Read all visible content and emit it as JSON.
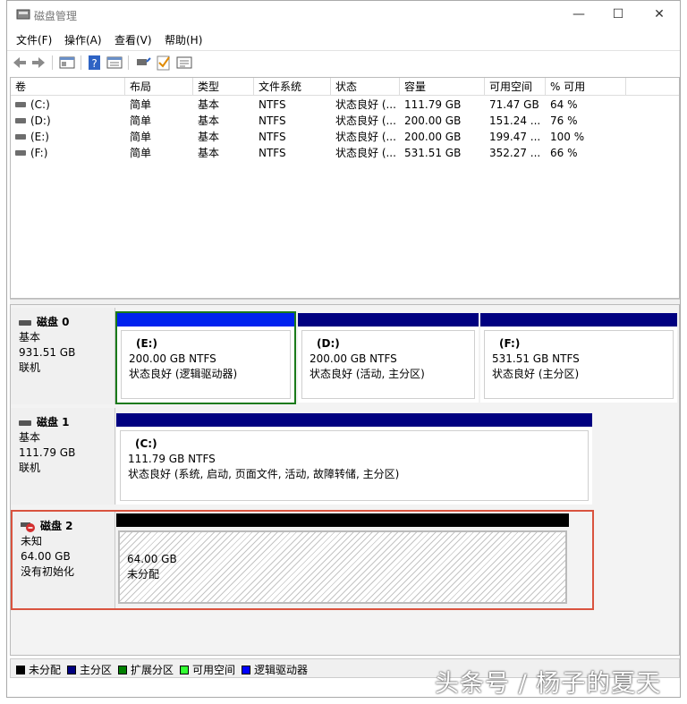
{
  "window": {
    "title": "磁盘管理",
    "minimize": "—",
    "maximize": "☐",
    "close": "✕"
  },
  "menu": [
    "文件(F)",
    "操作(A)",
    "查看(V)",
    "帮助(H)"
  ],
  "toolbar_icons": [
    "back-arrow-icon",
    "forward-arrow-icon",
    "console-tree-icon",
    "help-icon",
    "properties-icon",
    "connect-icon",
    "check-icon",
    "list-icon"
  ],
  "volume_table": {
    "columns": [
      "卷",
      "布局",
      "类型",
      "文件系统",
      "状态",
      "容量",
      "可用空间",
      "% 可用"
    ],
    "rows": [
      [
        "(C:)",
        "简单",
        "基本",
        "NTFS",
        "状态良好 (...",
        "111.79 GB",
        "71.47 GB",
        "64 %"
      ],
      [
        "(D:)",
        "简单",
        "基本",
        "NTFS",
        "状态良好 (...",
        "200.00 GB",
        "151.24 ...",
        "76 %"
      ],
      [
        "(E:)",
        "简单",
        "基本",
        "NTFS",
        "状态良好 (...",
        "200.00 GB",
        "199.47 ...",
        "100 %"
      ],
      [
        "(F:)",
        "简单",
        "基本",
        "NTFS",
        "状态良好 (...",
        "531.51 GB",
        "352.27 ...",
        "66 %"
      ]
    ]
  },
  "disks": [
    {
      "name": "磁盘 0",
      "type": "基本",
      "size": "931.51 GB",
      "status": "联机",
      "partitions": [
        {
          "label": "(E:)",
          "size": "200.00 GB NTFS",
          "status": "状态良好 (逻辑驱动器)"
        },
        {
          "label": "(D:)",
          "size": "200.00 GB NTFS",
          "status": "状态良好 (活动, 主分区)"
        },
        {
          "label": "(F:)",
          "size": "531.51 GB NTFS",
          "status": "状态良好 (主分区)"
        }
      ]
    },
    {
      "name": "磁盘 1",
      "type": "基本",
      "size": "111.79 GB",
      "status": "联机",
      "partitions": [
        {
          "label": "(C:)",
          "size": "111.79 GB NTFS",
          "status": "状态良好 (系统, 启动, 页面文件, 活动, 故障转储, 主分区)"
        }
      ]
    },
    {
      "name": "磁盘 2",
      "type": "未知",
      "size": "64.00 GB",
      "status": "没有初始化",
      "partitions": [
        {
          "size": "64.00 GB",
          "status": "未分配"
        }
      ]
    }
  ],
  "legend": [
    {
      "label": "未分配",
      "color": "#000000"
    },
    {
      "label": "主分区",
      "color": "#000080"
    },
    {
      "label": "扩展分区",
      "color": "#008000"
    },
    {
      "label": "可用空间",
      "color": "#33ff33"
    },
    {
      "label": "逻辑驱动器",
      "color": "#0000ff"
    }
  ],
  "colors": {
    "primary_bar": "#000080",
    "logical_bar": "#0022ee",
    "unallocated_bar": "#000000",
    "selected_border": "#1a7a1a",
    "disk2_border": "#d9533f"
  },
  "watermark": "头条号 / 杨子的夏天"
}
